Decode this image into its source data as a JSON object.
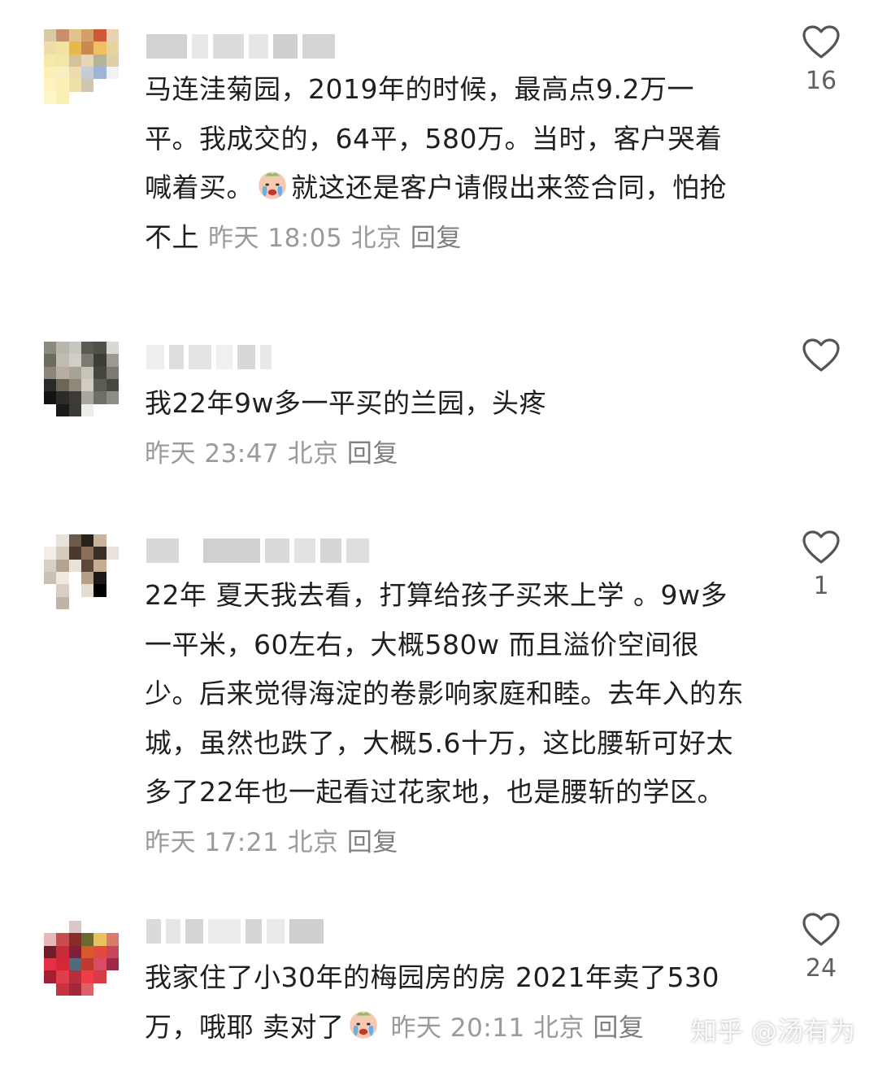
{
  "comments": [
    {
      "text": "马连洼菊园，2019年的时候，最高点9.2万一平。我成交的，64平，580万。当时，客户哭着喊着买。",
      "text_after_emoji": "就这还是客户请假出来签合同，怕抢不上",
      "time": "昨天 18:05",
      "location": "北京",
      "reply": "回复",
      "likes": "16",
      "emoji": "crying-face-emoji"
    },
    {
      "text": "我22年9w多一平买的兰园，头疼",
      "time": "昨天 23:47",
      "location": "北京",
      "reply": "回复",
      "likes": ""
    },
    {
      "text": "22年 夏天我去看，打算给孩子买来上学 。9w多一平米，60左右，大概580w  而且溢价空间很少。后来觉得海淀的卷影响家庭和睦。去年入的东城，虽然也跌了，大概5.6十万，这比腰斩可好太多了22年也一起看过花家地，也是腰斩的学区。",
      "time": "昨天 17:21",
      "location": "北京",
      "reply": "回复",
      "likes": "1"
    },
    {
      "text": "我家住了小30年的梅园房的房 2021年卖了530万，哦耶 卖对了",
      "time": "昨天 20:11",
      "location": "北京",
      "reply": "回复",
      "likes": "24",
      "emoji": "crying-face-emoji"
    }
  ],
  "watermark": "知乎 @汤有为",
  "colors": {
    "text": "#1f1f1f",
    "meta": "#9a9a9a",
    "icon": "#555555"
  }
}
